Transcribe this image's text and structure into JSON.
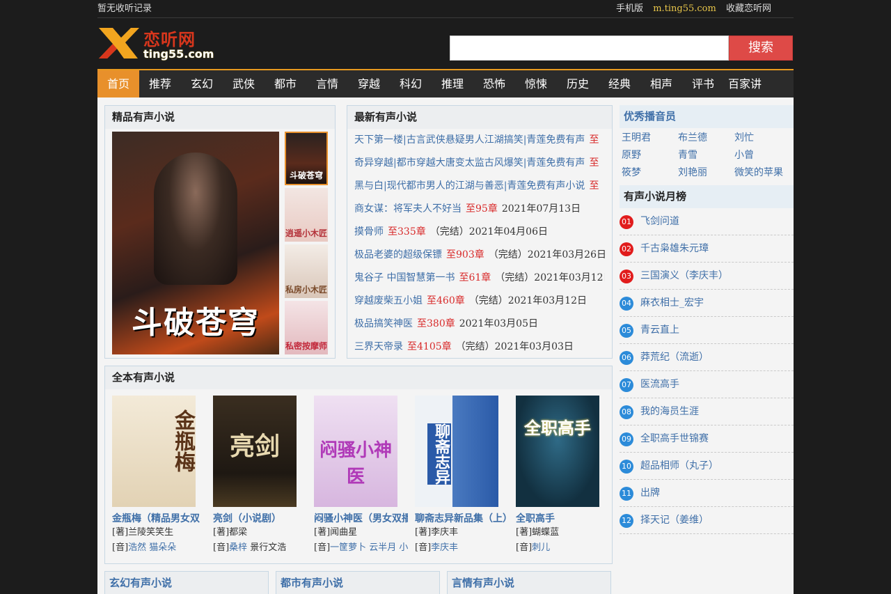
{
  "topbar": {
    "history": "暂无收听记录",
    "mobile_label": "手机版",
    "mobile_url": "m.ting55.com",
    "bookmark": "收藏恋听网"
  },
  "logo": {
    "title": "恋听网",
    "domain": "ting55.com"
  },
  "search": {
    "placeholder": "",
    "button": "搜索"
  },
  "nav": [
    "首页",
    "推荐",
    "玄幻",
    "武侠",
    "都市",
    "言情",
    "穿越",
    "科幻",
    "推理",
    "恐怖",
    "惊悚",
    "历史",
    "经典",
    "相声",
    "评书",
    "百家讲坛"
  ],
  "featured": {
    "title": "精品有声小说",
    "main_caption": "斗破苍穹",
    "thumbs": [
      "斗破苍穹",
      "逍遥小木匠",
      "私房小木匠",
      "私密按摩师"
    ]
  },
  "latest": {
    "title": "最新有声小说",
    "items": [
      {
        "name": "天下第一楼|古言武侠悬疑男人江湖搞笑|青莲免费有声",
        "chapter": "至",
        "status": "",
        "date": ""
      },
      {
        "name": "奇异穿越|都市穿越大唐变太监古风爆笑|青莲免费有声",
        "chapter": "至",
        "status": "",
        "date": ""
      },
      {
        "name": "黑与白|现代都市男人的江湖与善恶|青莲免费有声小说",
        "chapter": "至",
        "status": "",
        "date": ""
      },
      {
        "name": "商女谋：将军夫人不好当",
        "chapter": "至95章",
        "status": "",
        "date": "2021年07月13日"
      },
      {
        "name": "摸骨师",
        "chapter": "至335章",
        "status": "（完结）",
        "date": "2021年04月06日"
      },
      {
        "name": "极品老婆的超级保镖",
        "chapter": "至903章",
        "status": "（完结）",
        "date": "2021年03月26日"
      },
      {
        "name": "鬼谷子 中国智慧第一书",
        "chapter": "至61章",
        "status": "（完结）",
        "date": "2021年03月12日"
      },
      {
        "name": "穿越废柴五小姐",
        "chapter": "至460章",
        "status": "（完结）",
        "date": "2021年03月12日"
      },
      {
        "name": "极品搞笑神医",
        "chapter": "至380章",
        "status": "",
        "date": "2021年03月05日"
      },
      {
        "name": "三界天帝录",
        "chapter": "至4105章",
        "status": "（完结）",
        "date": "2021年03月03日"
      }
    ]
  },
  "complete": {
    "title": "全本有声小说",
    "books": [
      {
        "cover_text": "金瓶梅",
        "title": "金瓶梅（精品男女双",
        "author_prefix": "[著]",
        "author": "兰陵笑笑生",
        "voice_prefix": "[音]",
        "voice": "浩然 猫朵朵",
        "voice_extra": ""
      },
      {
        "cover_text": "亮剑",
        "title": "亮剑（小说剧）",
        "author_prefix": "[著]",
        "author": "都梁",
        "voice_prefix": "[音]",
        "voice": "桑梓",
        "voice_extra": " 景行文浩"
      },
      {
        "cover_text": "闷骚小神医",
        "title": "闷骚小神医（男女双播",
        "author_prefix": "[著]",
        "author": "闻曲星",
        "voice_prefix": "[音]",
        "voice": "一筐萝卜 云半月 小",
        "voice_extra": ""
      },
      {
        "cover_text": "聊斋志异",
        "title": "聊斋志异新品集（上）",
        "author_prefix": "[著]",
        "author": "李庆丰",
        "voice_prefix": "[音]",
        "voice": "李庆丰",
        "voice_extra": ""
      },
      {
        "cover_text": "全职高手",
        "title": "全职高手",
        "author_prefix": "[著]",
        "author": "蝴蝶蓝",
        "voice_prefix": "[音]",
        "voice": "刺儿",
        "voice_extra": ""
      }
    ]
  },
  "categories": [
    "玄幻有声小说",
    "都市有声小说",
    "言情有声小说"
  ],
  "narrators": {
    "title": "优秀播音员",
    "names": [
      "王明君",
      "布兰德",
      "刘忙",
      "原野",
      "青雪",
      "小曾",
      "筱梦",
      "刘艳丽",
      "微笑的苹果"
    ]
  },
  "monthly": {
    "title": "有声小说月榜",
    "items": [
      {
        "rank": "01",
        "name": "飞剑问道"
      },
      {
        "rank": "02",
        "name": "千古枭雄朱元璋"
      },
      {
        "rank": "03",
        "name": "三国演义（李庆丰）"
      },
      {
        "rank": "04",
        "name": "麻衣相士_宏宇"
      },
      {
        "rank": "05",
        "name": "青云直上"
      },
      {
        "rank": "06",
        "name": "莽荒纪（流逝）"
      },
      {
        "rank": "07",
        "name": "医流高手"
      },
      {
        "rank": "08",
        "name": "我的海员生涯"
      },
      {
        "rank": "09",
        "name": "全职高手世锦赛"
      },
      {
        "rank": "10",
        "name": "超品相师（丸子）"
      },
      {
        "rank": "11",
        "name": "出牌"
      },
      {
        "rank": "12",
        "name": "择天记（姜维）"
      }
    ]
  },
  "colors": {
    "accent": "#e8902b",
    "link": "#3f6fa8",
    "chapter": "#d82a2a",
    "search_button": "#de4a47",
    "rank_hot": "#e11c1c",
    "rank": "#2c8bd9"
  }
}
